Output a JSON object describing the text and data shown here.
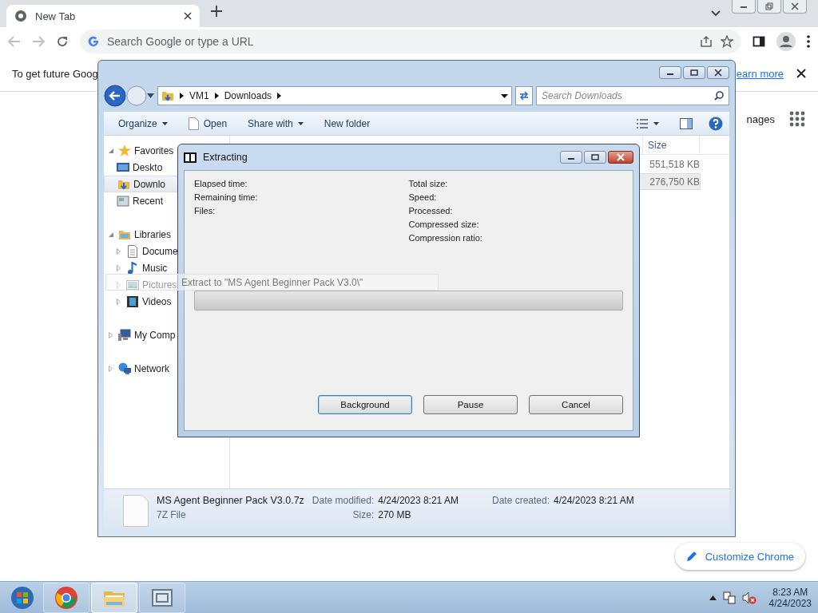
{
  "browser": {
    "tab": {
      "title": "New Tab"
    },
    "omnibox": {
      "placeholder": "Search Google or type a URL"
    },
    "infobar": {
      "text": "To get future Goog",
      "link": "earn more"
    },
    "page": {
      "apps_label": "nages",
      "customize_button": "Customize Chrome"
    }
  },
  "explorer": {
    "breadcrumb": [
      "VM1",
      "Downloads"
    ],
    "search": {
      "placeholder": "Search Downloads"
    },
    "toolbar": [
      {
        "label": "Organize",
        "kind": "menu"
      },
      {
        "label": "Open",
        "kind": "open"
      },
      {
        "label": "Share with",
        "kind": "menu"
      },
      {
        "label": "New folder",
        "kind": "plain"
      }
    ],
    "nav": [
      {
        "label": "Favorites",
        "kind": "star",
        "expanded": true,
        "selected": false,
        "children": [
          {
            "label": "Deskto",
            "kind": "desktop",
            "selected": false
          },
          {
            "label": "Downlo",
            "kind": "downloads",
            "selected": true
          },
          {
            "label": "Recent",
            "kind": "recent",
            "selected": false
          }
        ]
      },
      {
        "label": "Libraries",
        "kind": "library",
        "expanded": true,
        "selected": false,
        "children": [
          {
            "label": "Docume",
            "kind": "documents",
            "selected": false
          },
          {
            "label": "Music",
            "kind": "music",
            "selected": false
          },
          {
            "label": "Pictures",
            "kind": "pictures",
            "selected": false
          },
          {
            "label": "Videos",
            "kind": "videos",
            "selected": false
          }
        ]
      },
      {
        "label": "My Comp",
        "kind": "computer",
        "expanded": false,
        "selected": false
      },
      {
        "label": "Network",
        "kind": "network",
        "expanded": false,
        "selected": false
      }
    ],
    "columns": [
      {
        "label": "Size"
      }
    ],
    "rows": [
      {
        "size": "551,518 KB",
        "selected": false
      },
      {
        "size": "276,750 KB",
        "selected": true
      }
    ],
    "details": {
      "name": "MS Agent Beginner Pack V3.0.7z",
      "type": "7Z File",
      "field_columns": [
        [
          {
            "label": "Date modified:",
            "value": "4/24/2023 8:21 AM"
          },
          {
            "label": "Size:",
            "value": "270 MB"
          }
        ],
        [
          {
            "label": "Date created:",
            "value": "4/24/2023 8:21 AM"
          }
        ]
      ]
    }
  },
  "drag_tooltip": {
    "text": "Extract to \"MS Agent Beginner Pack V3.0\\\""
  },
  "dialog": {
    "title": "Extracting",
    "left_labels": [
      "Elapsed time:",
      "Remaining time:",
      "Files:"
    ],
    "right_labels": [
      "Total size:",
      "Speed:",
      "Processed:",
      "Compressed size:",
      "Compression ratio:"
    ],
    "progress": {
      "level": 0
    },
    "buttons": [
      {
        "label": "Background",
        "focused": true
      },
      {
        "label": "Pause",
        "focused": false
      },
      {
        "label": "Cancel",
        "focused": false
      }
    ]
  },
  "taskbar": {
    "apps": [
      {
        "kind": "chrome",
        "active": false
      },
      {
        "kind": "explorer",
        "active": true
      },
      {
        "kind": "sevenzip",
        "active": false
      }
    ],
    "time": "8:23 AM",
    "date": "4/24/2023"
  }
}
